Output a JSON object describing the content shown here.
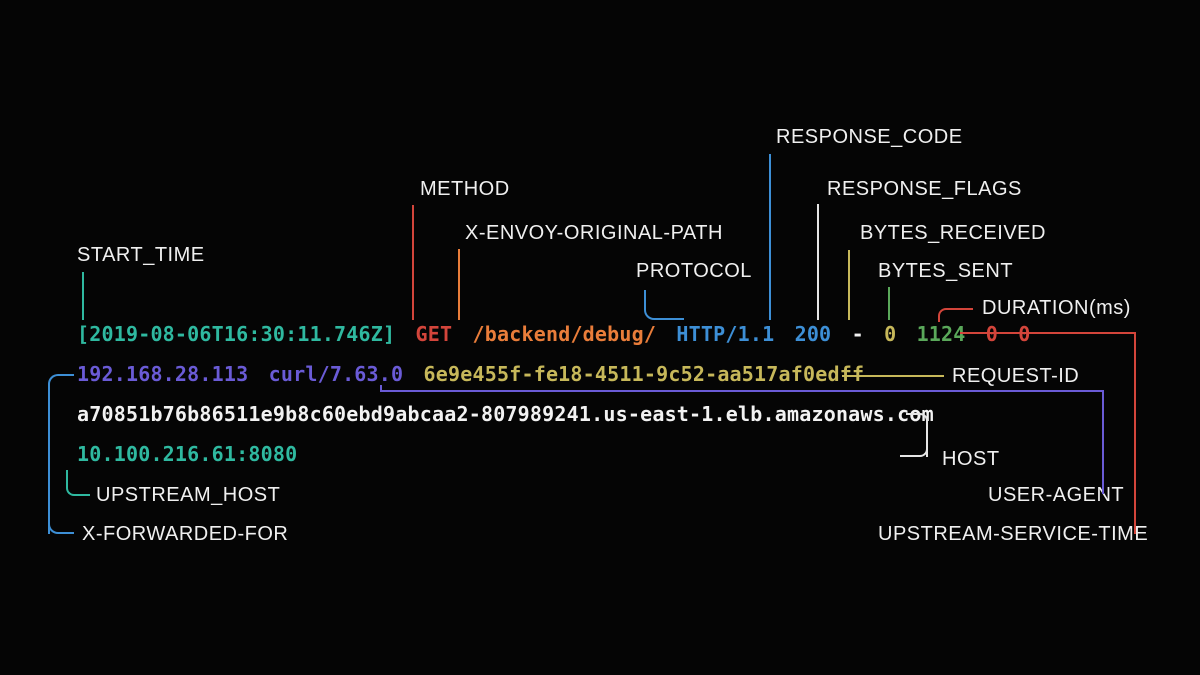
{
  "labels": {
    "start_time": "START_TIME",
    "method": "METHOD",
    "x_envoy_original_path": "X-ENVOY-ORIGINAL-PATH",
    "protocol": "PROTOCOL",
    "response_code": "RESPONSE_CODE",
    "response_flags": "RESPONSE_FLAGS",
    "bytes_received": "BYTES_RECEIVED",
    "bytes_sent": "BYTES_SENT",
    "duration": "DURATION(ms)",
    "upstream_service_time": "UPSTREAM-SERVICE-TIME",
    "x_forwarded_for": "X-FORWARDED-FOR",
    "user_agent": "USER-AGENT",
    "request_id": "REQUEST-ID",
    "host": "HOST",
    "upstream_host": "UPSTREAM_HOST"
  },
  "log": {
    "start_time": "[2019-08-06T16:30:11.746Z]",
    "method": "GET",
    "path": "/backend/debug/",
    "protocol": "HTTP/1.1",
    "response_code": "200",
    "response_flags": "-",
    "bytes_received": "0",
    "bytes_sent": "1124",
    "duration_ms": "0",
    "upstream_service_time": "0",
    "x_forwarded_for": "192.168.28.113",
    "user_agent": "curl/7.63.0",
    "request_id": "6e9e455f-fe18-4511-9c52-aa517af0edff",
    "host": "a70851b76b86511e9b8c60ebd9abcaa2-807989241.us-east-1.elb.amazonaws.com",
    "upstream_host": "10.100.216.61:8080"
  },
  "colors": {
    "teal": "#2fb9a0",
    "red": "#d3453b",
    "orange": "#e97d3a",
    "blue": "#3d8fd6",
    "purple": "#6a5bd6",
    "khaki": "#c7b85a",
    "green": "#5aa85a",
    "white": "#f2f2f2"
  }
}
